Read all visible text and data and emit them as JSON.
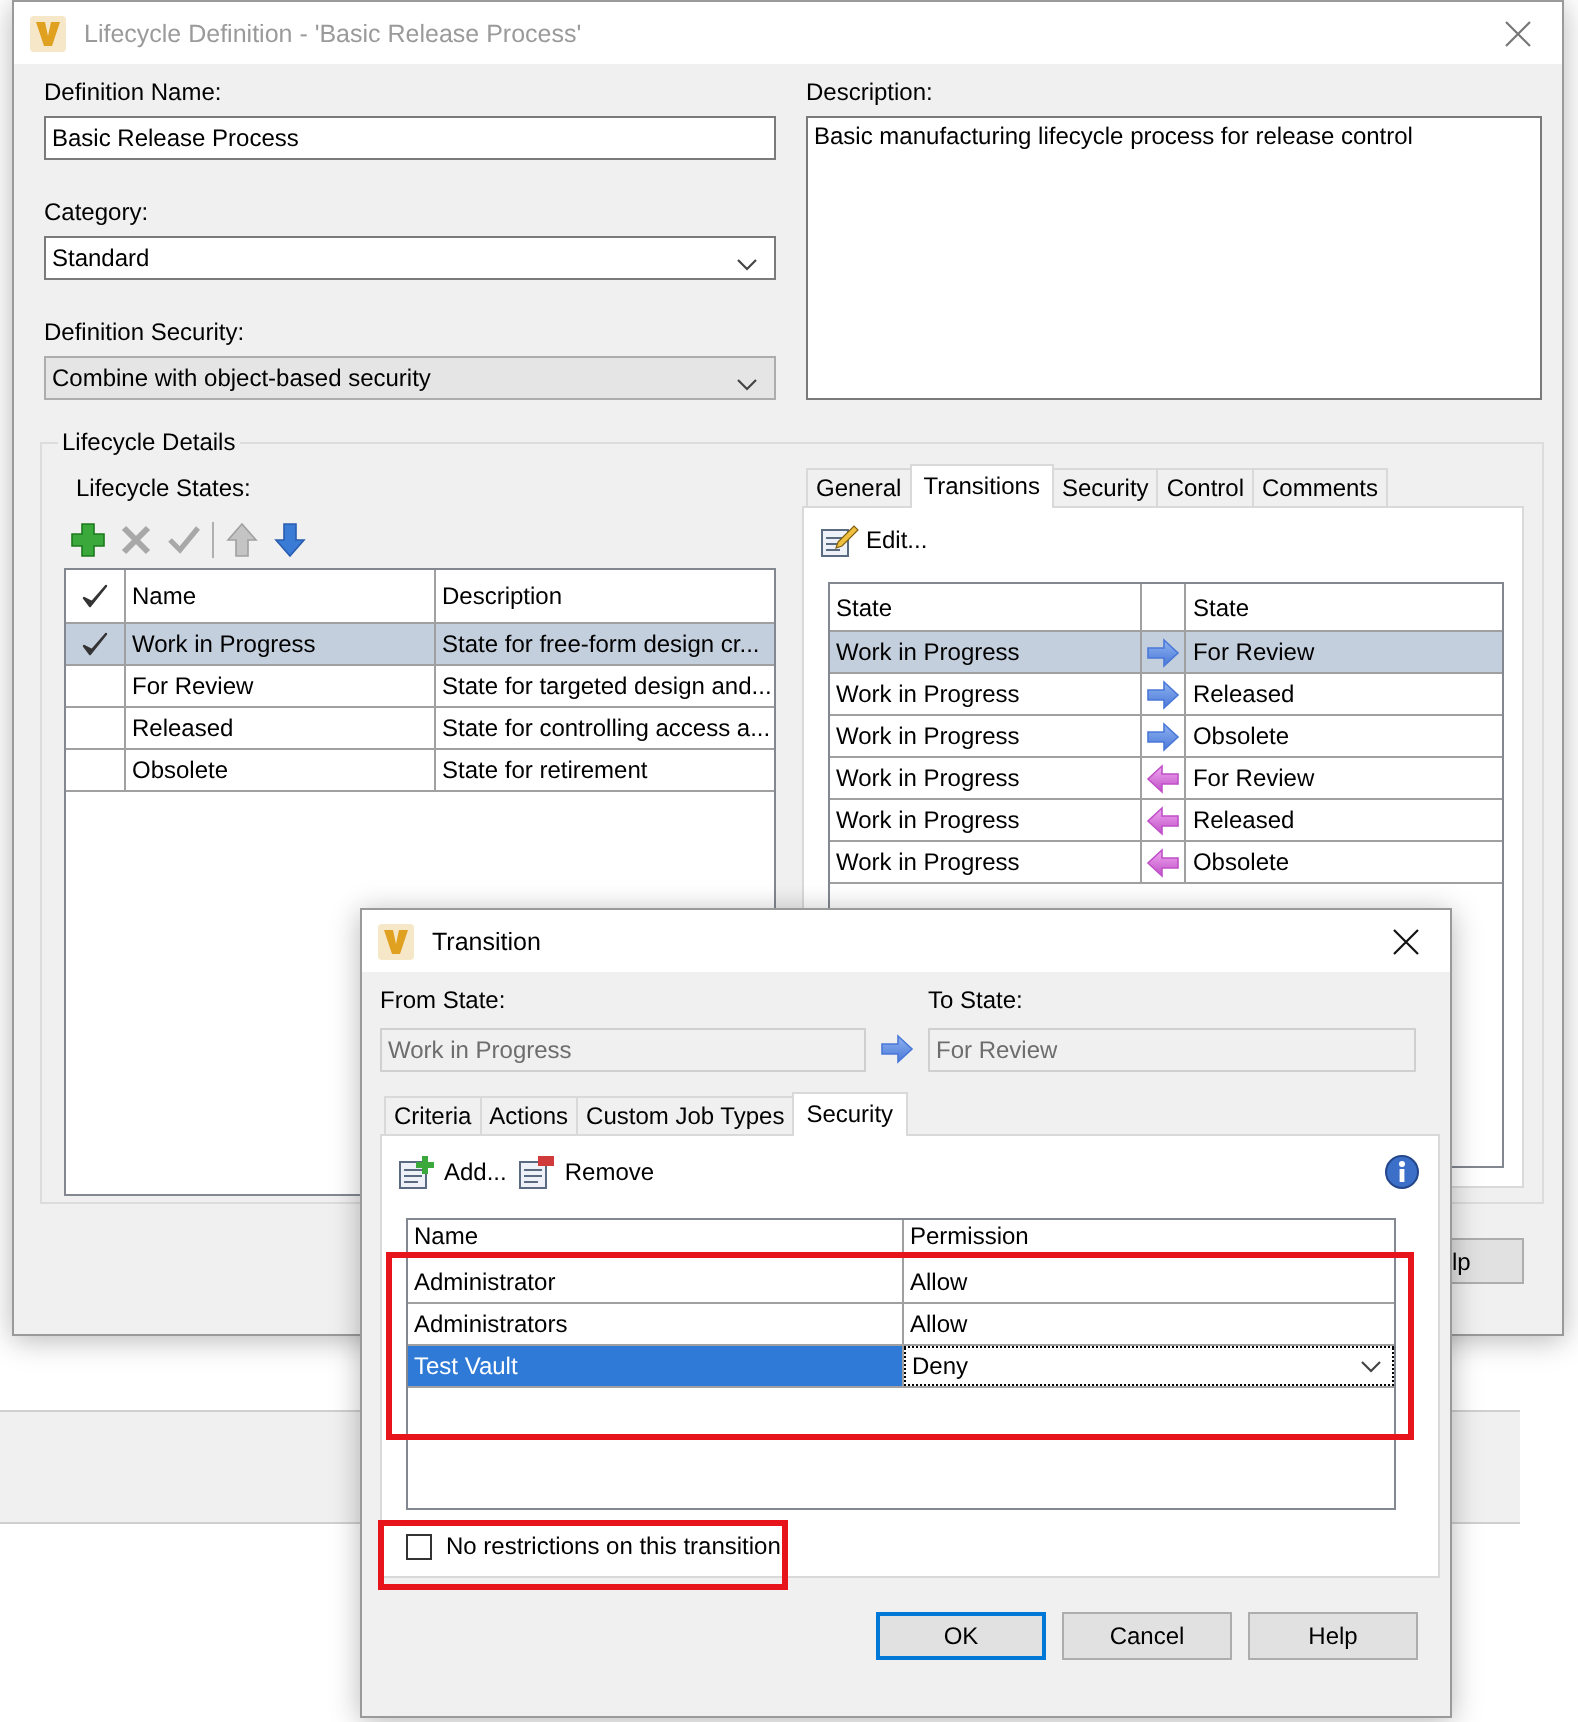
{
  "main_window": {
    "title": "Lifecycle Definition - 'Basic Release Process'",
    "active": false,
    "definition_name": {
      "label": "Definition Name:",
      "value": "Basic Release Process"
    },
    "category": {
      "label": "Category:",
      "value": "Standard",
      "editable": true
    },
    "definition_security": {
      "label": "Definition Security:",
      "value": "Combine with object-based security",
      "editable": false
    },
    "description": {
      "label": "Description:",
      "value": "Basic manufacturing lifecycle process for release control"
    },
    "lifecycle_details": {
      "title": "Lifecycle Details",
      "states_label": "Lifecycle States:",
      "toolbar": [
        {
          "kind": "add",
          "disabled": false
        },
        {
          "kind": "delete",
          "disabled": true
        },
        {
          "kind": "check",
          "disabled": true
        },
        {
          "kind": "up",
          "disabled": true
        },
        {
          "kind": "down",
          "disabled": false
        }
      ],
      "states_table": {
        "columns": [
          "Name",
          "Description"
        ],
        "rows": [
          {
            "default": true,
            "name": "Work in Progress",
            "description": "State for free-form design cr...",
            "selected": true
          },
          {
            "default": false,
            "name": "For Review",
            "description": "State for targeted design and...",
            "selected": false
          },
          {
            "default": false,
            "name": "Released",
            "description": "State for controlling access a...",
            "selected": false
          },
          {
            "default": false,
            "name": "Obsolete",
            "description": "State for retirement",
            "selected": false
          }
        ]
      },
      "tabs": [
        {
          "label": "General",
          "selected": false
        },
        {
          "label": "Transitions",
          "selected": true
        },
        {
          "label": "Security",
          "selected": false
        },
        {
          "label": "Control",
          "selected": false
        },
        {
          "label": "Comments",
          "selected": false
        }
      ],
      "edit_button": "Edit...",
      "transitions_table": {
        "from_column": "State",
        "to_column": "State",
        "rows": [
          {
            "from": "Work in Progress",
            "kind": "forward",
            "to": "For Review",
            "selected": true
          },
          {
            "from": "Work in Progress",
            "kind": "forward",
            "to": "Released",
            "selected": false
          },
          {
            "from": "Work in Progress",
            "kind": "forward",
            "to": "Obsolete",
            "selected": false
          },
          {
            "from": "Work in Progress",
            "kind": "backward",
            "to": "For Review",
            "selected": false
          },
          {
            "from": "Work in Progress",
            "kind": "backward",
            "to": "Released",
            "selected": false
          },
          {
            "from": "Work in Progress",
            "kind": "backward",
            "to": "Obsolete",
            "selected": false
          }
        ]
      }
    },
    "help_button_fragment": "lp"
  },
  "transition_window": {
    "title": "Transition",
    "active": true,
    "from_state": {
      "label": "From State:",
      "value": "Work in Progress",
      "disabled": true
    },
    "to_state": {
      "label": "To State:",
      "value": "For Review",
      "disabled": true
    },
    "tabs": [
      {
        "label": "Criteria",
        "selected": false
      },
      {
        "label": "Actions",
        "selected": false
      },
      {
        "label": "Custom Job Types",
        "selected": false
      },
      {
        "label": "Security",
        "selected": true
      }
    ],
    "add_button": "Add...",
    "remove_button": "Remove",
    "permissions_table": {
      "columns": [
        "Name",
        "Permission"
      ],
      "rows": [
        {
          "name": "Administrator",
          "permission": "Allow",
          "selected": false
        },
        {
          "name": "Administrators",
          "permission": "Allow",
          "selected": false
        },
        {
          "name": "Test Vault",
          "permission": "Deny",
          "selected": true
        }
      ]
    },
    "no_restrictions": {
      "label": "No restrictions on this transition",
      "checked": false
    },
    "buttons": [
      {
        "label": "OK",
        "default": true
      },
      {
        "label": "Cancel",
        "default": false
      },
      {
        "label": "Help",
        "default": false
      }
    ]
  }
}
